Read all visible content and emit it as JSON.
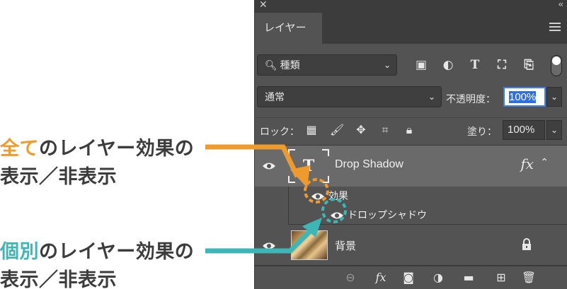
{
  "annotations": {
    "all_effects": {
      "highlight": "全て",
      "line1_rest": "のレイヤー効果の",
      "line2": "表示／非表示"
    },
    "individual_effects": {
      "highlight": "個別",
      "line1_rest": "のレイヤー効果の",
      "line2": "表示／非表示"
    }
  },
  "colors": {
    "orange": "#ee9a2d",
    "teal": "#3fb6b6",
    "panel_bg": "#535353",
    "selected_layer": "#6a6a6a"
  },
  "panel": {
    "tab_label": "レイヤー",
    "filter": {
      "kind_label": "種類",
      "icons": [
        "image-filter-icon",
        "adjustment-filter-icon",
        "type-filter-icon",
        "shape-filter-icon",
        "smart-object-filter-icon"
      ]
    },
    "blend_mode": "通常",
    "opacity": {
      "label": "不透明度：",
      "value": "100%"
    },
    "lock": {
      "label": "ロック：",
      "icons": [
        "lock-transparent-icon",
        "lock-brush-icon",
        "lock-move-icon",
        "lock-artboard-icon",
        "lock-all-icon"
      ]
    },
    "fill": {
      "label": "塗り：",
      "value": "100%"
    },
    "layers": {
      "text_layer": {
        "thumb_glyph": "T",
        "name": "Drop Shadow",
        "fx": "fx"
      },
      "effects_label": "効果",
      "drop_shadow_label": "ドロップシャドウ",
      "background_layer": {
        "name": "背景"
      }
    },
    "bottom_icons": [
      "link-icon",
      "fx-icon",
      "mask-icon",
      "adjustment-icon",
      "folder-icon",
      "new-layer-icon",
      "trash-icon"
    ]
  }
}
